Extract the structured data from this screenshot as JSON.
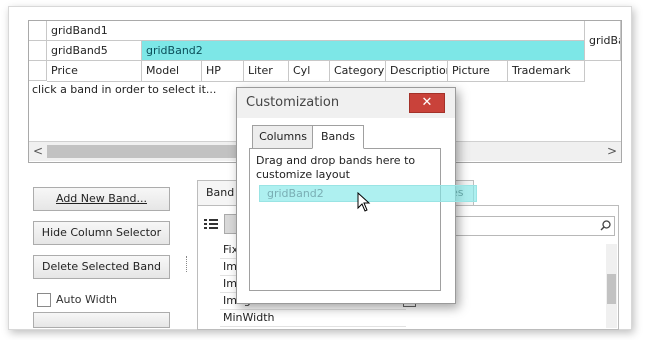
{
  "grid": {
    "bands": [
      "gridBand1",
      "gridBand5",
      "gridBand2",
      "gridBa"
    ],
    "columns": [
      "Price",
      "Model",
      "HP",
      "Liter",
      "Cyl",
      "Category",
      "Description",
      "Picture",
      "Trademark"
    ],
    "hint": "click a band in order to select it...",
    "scroll_left": "<",
    "scroll_right": ">"
  },
  "buttons": {
    "add_new_band": "Add New Band...",
    "hide_column_selector": "Hide Column Selector",
    "delete_selected_band": "Delete Selected Band"
  },
  "auto_width_label": "Auto Width",
  "properties": {
    "tab_left": "Band p",
    "tab_right": "es",
    "rows": [
      "Fix",
      "Ima",
      "Ima",
      "ImageIndex",
      "MinWidth"
    ]
  },
  "dialog": {
    "title": "Customization",
    "close": "✕",
    "tabs": [
      "Columns",
      "Bands"
    ],
    "message": "Drag and drop bands here to customize layout",
    "drag_band": "gridBand2"
  },
  "colors": {
    "selected_band": "#7de7e7",
    "close_button": "#c9423a"
  }
}
